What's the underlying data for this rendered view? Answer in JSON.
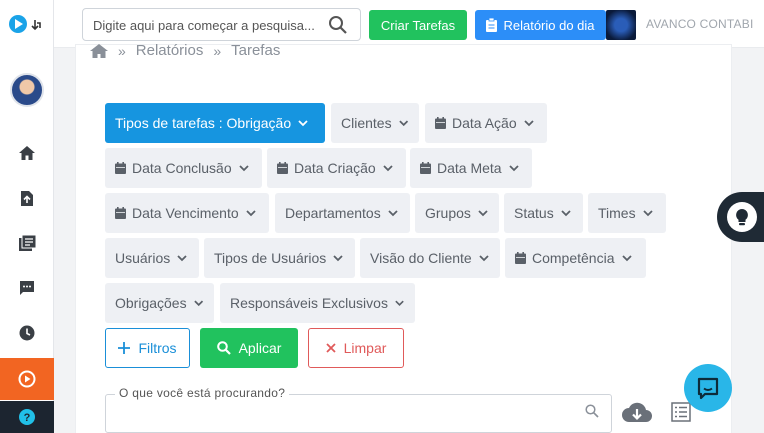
{
  "topbar": {
    "search_placeholder": "Digite aqui para começar a pesquisa...",
    "create_tasks_label": "Criar Tarefas",
    "daily_report_label": "Relatório do dia",
    "company_name": "AVANCO CONTABI"
  },
  "breadcrumb": {
    "items": [
      "Relatórios",
      "Tarefas"
    ]
  },
  "filters": {
    "task_types": "Tipos de tarefas : Obrigação",
    "clients": "Clientes",
    "action_date": "Data Ação",
    "conclusion_date": "Data Conclusão",
    "creation_date": "Data Criação",
    "goal_date": "Data Meta",
    "due_date": "Data Vencimento",
    "departments": "Departamentos",
    "groups": "Grupos",
    "status": "Status",
    "teams": "Times",
    "users": "Usuários",
    "user_types": "Tipos de Usuários",
    "client_view": "Visão do Cliente",
    "competence": "Competência",
    "obligations": "Obrigações",
    "exclusive_owners": "Responsáveis Exclusivos"
  },
  "actions": {
    "filters_label": "Filtros",
    "apply_label": "Aplicar",
    "clear_label": "Limpar"
  },
  "search": {
    "label": "O que você está procurando?"
  },
  "colors": {
    "primary_blue": "#1695e0",
    "green": "#21c25e",
    "red": "#e05a5a",
    "orange_active": "#f26522"
  }
}
